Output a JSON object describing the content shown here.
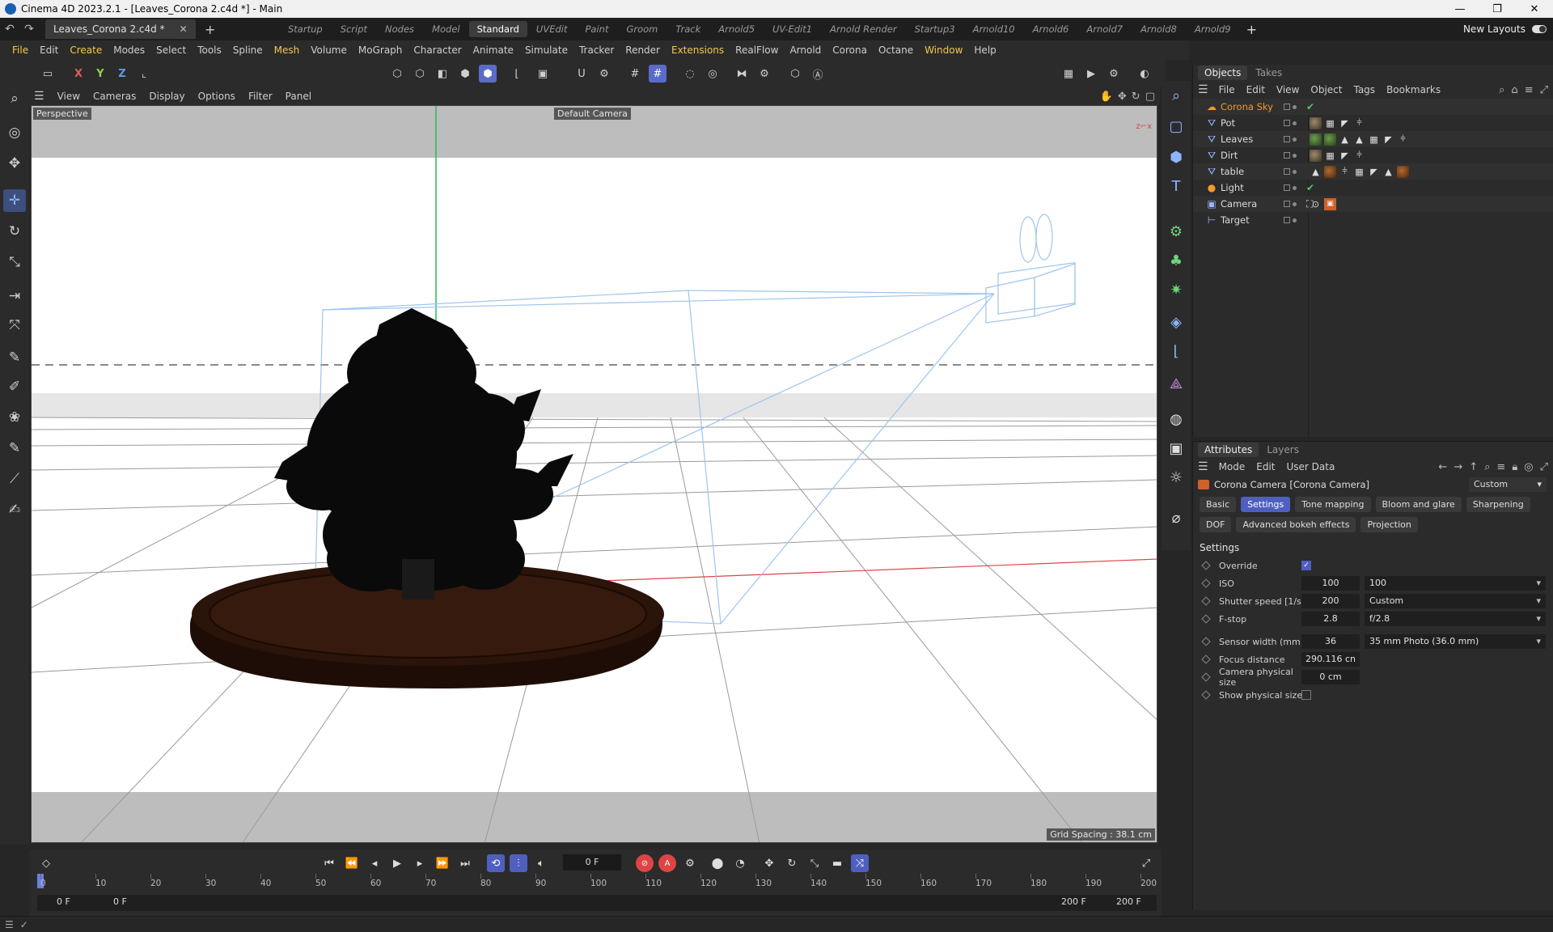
{
  "window": {
    "title": "Cinema 4D 2023.2.1 - [Leaves_Corona 2.c4d *] - Main",
    "minimize": "—",
    "maximize": "❐",
    "close": "✕"
  },
  "doc_tab": {
    "label": "Leaves_Corona 2.c4d *",
    "close": "✕"
  },
  "layouts": [
    "Startup",
    "Script",
    "Nodes",
    "Model",
    "Standard",
    "UVEdit",
    "Paint",
    "Groom",
    "Track",
    "Arnold5",
    "UV-Edit1",
    "Arnold Render",
    "Startup3",
    "Arnold10",
    "Arnold6",
    "Arnold7",
    "Arnold8",
    "Arnold9"
  ],
  "layout_active": "Standard",
  "new_layouts": "New Layouts",
  "menus": [
    "File",
    "Edit",
    "Create",
    "Modes",
    "Select",
    "Tools",
    "Spline",
    "Mesh",
    "Volume",
    "MoGraph",
    "Character",
    "Animate",
    "Simulate",
    "Tracker",
    "Render",
    "Extensions",
    "RealFlow",
    "Arnold",
    "Corona",
    "Octane",
    "Window",
    "Help"
  ],
  "menus_highlighted": [
    "File",
    "Create",
    "Mesh",
    "Extensions",
    "Window"
  ],
  "axis_buttons": {
    "x": "X",
    "y": "Y",
    "z": "Z"
  },
  "viewport": {
    "menu": [
      "View",
      "Cameras",
      "Display",
      "Options",
      "Filter",
      "Panel"
    ],
    "projection": "Perspective",
    "camera": "Default Camera",
    "grid_spacing": "Grid Spacing : 38.1 cm",
    "background": "#ffffff",
    "table_color": "#2b140a",
    "camera_wire_color": "#9ec5ee"
  },
  "objects_panel": {
    "tabs": [
      "Objects",
      "Takes"
    ],
    "menu": [
      "File",
      "Edit",
      "View",
      "Object",
      "Tags",
      "Bookmarks"
    ],
    "items": [
      {
        "name": "Corona Sky",
        "icon": "sky-icon",
        "selected": true,
        "check": "✔"
      },
      {
        "name": "Pot",
        "icon": "object-icon"
      },
      {
        "name": "Leaves",
        "icon": "object-icon"
      },
      {
        "name": "Dirt",
        "icon": "object-icon"
      },
      {
        "name": "table",
        "icon": "object-icon"
      },
      {
        "name": "Light",
        "icon": "light-icon",
        "check": "✔"
      },
      {
        "name": "Camera",
        "icon": "camera-icon"
      },
      {
        "name": "Target",
        "icon": "target-icon"
      }
    ]
  },
  "attributes_panel": {
    "tabs": [
      "Attributes",
      "Layers"
    ],
    "menu": [
      "Mode",
      "Edit",
      "User Data"
    ],
    "object_title": "Corona Camera [Corona Camera]",
    "preset": "Custom",
    "buttons": [
      "Basic",
      "Settings",
      "Tone mapping",
      "Bloom and glare",
      "Sharpening",
      "DOF",
      "Advanced bokeh effects",
      "Projection"
    ],
    "active_button": "Settings",
    "section": "Settings",
    "props": {
      "override": {
        "label": "Override",
        "checked": true
      },
      "iso": {
        "label": "ISO",
        "value": "100",
        "select": "100"
      },
      "shutter": {
        "label": "Shutter speed [1/s]",
        "value": "200",
        "select": "Custom"
      },
      "fstop": {
        "label": "F-stop",
        "value": "2.8",
        "select": "f/2.8"
      },
      "sensor": {
        "label": "Sensor width (mm)",
        "value": "36",
        "select": "35 mm Photo (36.0 mm)"
      },
      "focus": {
        "label": "Focus distance",
        "value": "290.116 cn"
      },
      "physical": {
        "label": "Camera physical size",
        "value": "0 cm"
      },
      "show_physical": {
        "label": "Show physical size",
        "checked": false
      }
    }
  },
  "timeline": {
    "current_frame": "0 F",
    "ticks": [
      "0",
      "10",
      "20",
      "30",
      "40",
      "50",
      "60",
      "70",
      "80",
      "90",
      "100",
      "110",
      "120",
      "130",
      "140",
      "150",
      "160",
      "170",
      "180",
      "190",
      "200"
    ],
    "range_start": "0 F",
    "range_start2": "0 F",
    "range_end": "200 F",
    "range_end2": "200 F"
  }
}
